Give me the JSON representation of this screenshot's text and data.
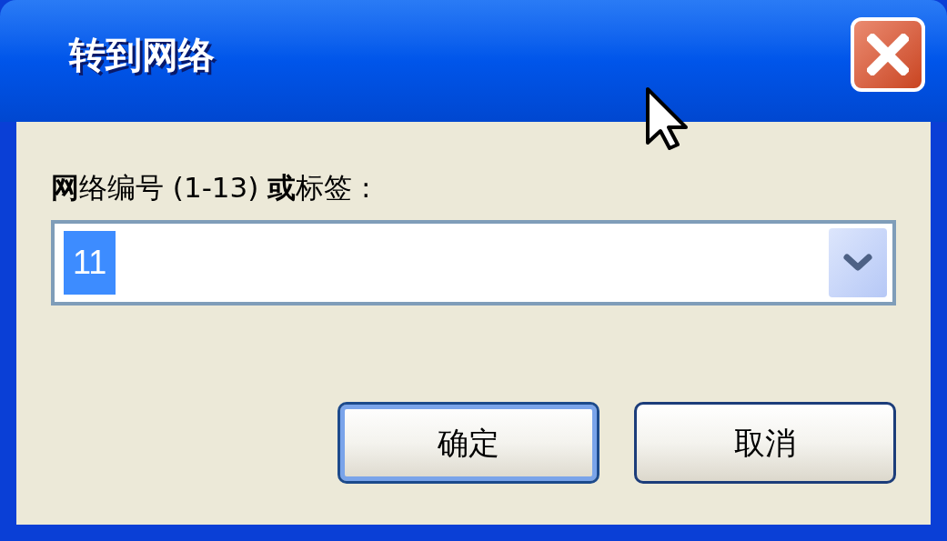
{
  "window": {
    "title": "转到网络"
  },
  "field_label": "**网**络编号 (1-13) **或**标签 :",
  "combo": {
    "value": "11",
    "text_selected": true
  },
  "buttons": [
    {
      "label": "确定",
      "default": true
    },
    {
      "label": "取消",
      "default": false
    }
  ]
}
